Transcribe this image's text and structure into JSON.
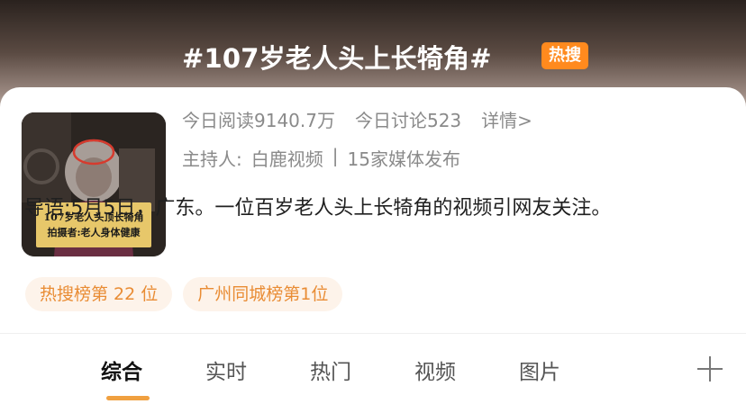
{
  "topic": {
    "title": "#107岁老人头上长犄角#",
    "badge": "热搜",
    "cover_caption_line1": "107岁老人头顶长犄角",
    "cover_caption_line2": "拍摄者:老人身体健康"
  },
  "stats": {
    "reads": "今日阅读9140.7万",
    "discussions": "今日讨论523",
    "details_link": "详情>"
  },
  "host": {
    "label": "主持人:",
    "name": "白鹿视频",
    "separator": "|",
    "media": "15家媒体发布"
  },
  "lead": {
    "label": "导语:",
    "text": "5月5日，广东。一位百岁老人头上长犄角的视频引网友关注。"
  },
  "rank_chips": [
    "热搜榜第 22 位",
    "广州同城榜第1位"
  ],
  "tabs": [
    {
      "label": "综合",
      "active": true
    },
    {
      "label": "实时",
      "active": false
    },
    {
      "label": "热门",
      "active": false
    },
    {
      "label": "视频",
      "active": false
    },
    {
      "label": "图片",
      "active": false
    }
  ],
  "colors": {
    "badge": "#ff8a1e",
    "chip_text": "#e98c34",
    "chip_bg": "#fdf3ea",
    "tab_indicator": "#f0a040"
  },
  "icons": {
    "add_tab": "plus-icon"
  }
}
